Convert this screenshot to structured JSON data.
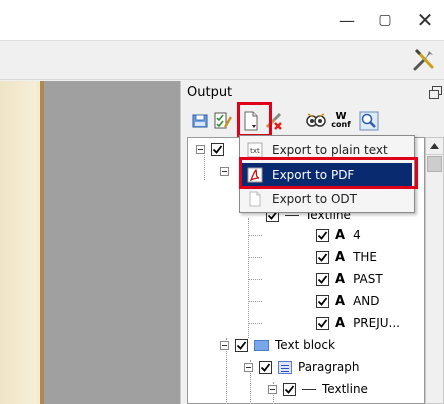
{
  "window": {
    "minimize_glyph": "—",
    "restore_glyph": "▢",
    "close_glyph": "✕"
  },
  "panel": {
    "title": "Output",
    "toolbar": {
      "wconf_label_top": "W",
      "wconf_label_bottom": "conf"
    }
  },
  "export_menu": {
    "items": [
      {
        "label": "Export to plain text",
        "icon": "txt",
        "active": false
      },
      {
        "label": "Export to PDF",
        "icon": "pdf-icon",
        "active": true
      },
      {
        "label": "Export to ODT",
        "icon": "odt-icon",
        "active": false
      }
    ]
  },
  "tree": {
    "textline_top": "Textline",
    "words": [
      "4",
      "THE",
      "PAST",
      "AND",
      "PREJU..."
    ],
    "word_glyph": "A",
    "text_block": "Text block",
    "paragraph": "Paragraph",
    "textline": "Textline"
  },
  "colors": {
    "highlight": "#e0001a",
    "menu_active": "#0a2a70"
  }
}
